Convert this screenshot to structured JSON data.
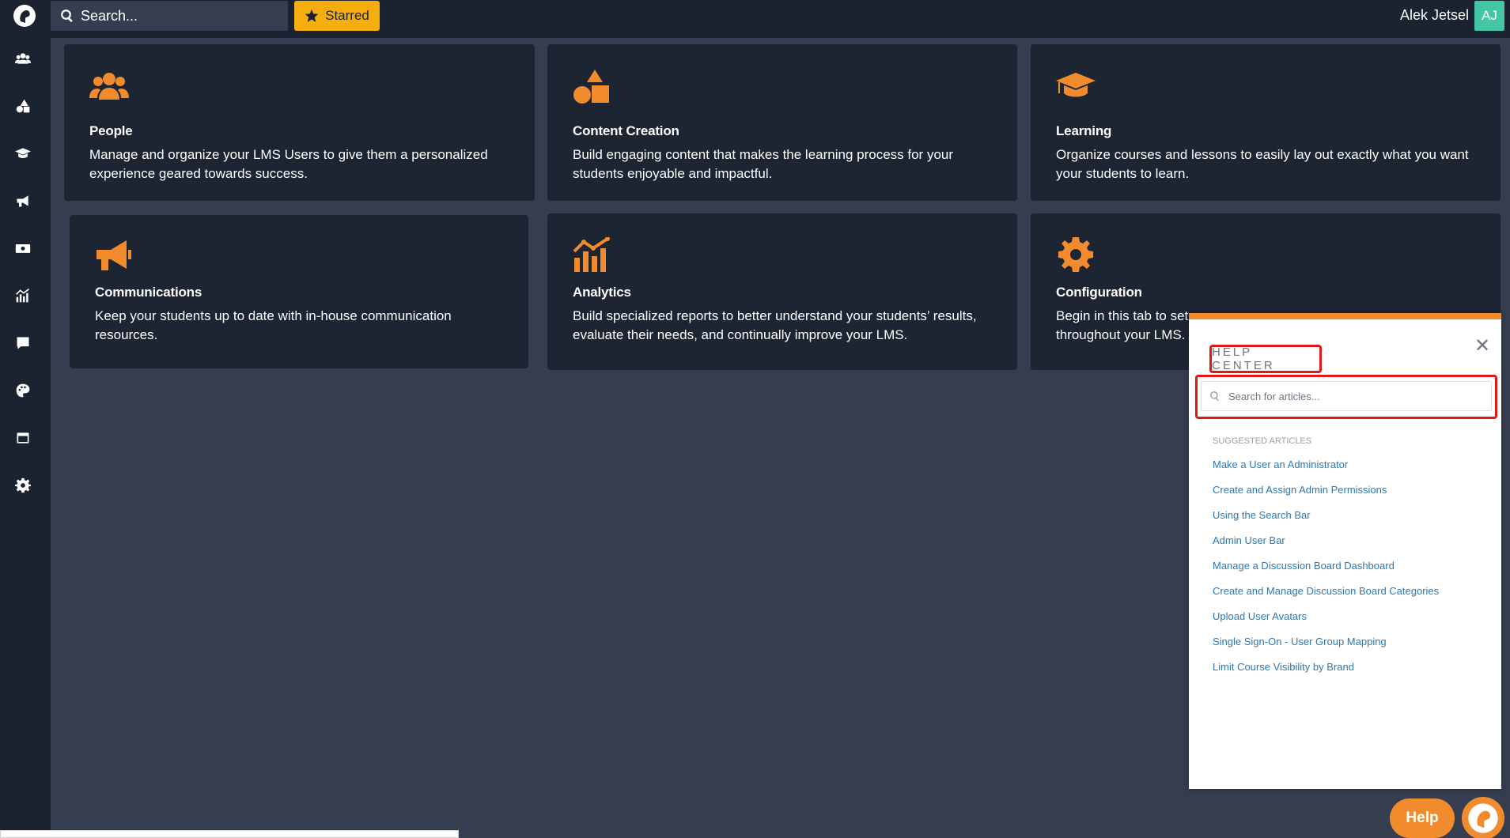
{
  "topbar": {
    "search_placeholder": "Search...",
    "starred_label": "Starred",
    "user_name": "Alek Jetsel",
    "user_initials": "AJ"
  },
  "sidebar": {
    "icons": [
      "logo-icon",
      "users-icon",
      "shapes-icon",
      "graduation-cap-icon",
      "megaphone-icon",
      "money-icon",
      "analytics-icon",
      "comment-icon",
      "palette-icon",
      "window-icon",
      "gear-icon"
    ]
  },
  "cards": [
    {
      "title": "People",
      "description": "Manage and organize your LMS Users to give them a personalized experience geared towards success.",
      "icon": "users-icon"
    },
    {
      "title": "Content Creation",
      "description": "Build engaging content that makes the learning process for your students enjoyable and impactful.",
      "icon": "shapes-icon"
    },
    {
      "title": "Learning",
      "description": "Organize courses and lessons to easily lay out exactly what you want your students to learn.",
      "icon": "graduation-cap-icon"
    },
    {
      "title": "Communications",
      "description": "Keep your students up to date with in-house communication resources.",
      "icon": "megaphone-icon"
    },
    {
      "title": "Analytics",
      "description": "Build specialized reports to better understand your students’ results, evaluate their needs, and continually improve your LMS.",
      "icon": "analytics-icon"
    },
    {
      "title": "Configuration",
      "description": "Begin in this tab to set",
      "description_line2": "throughout your LMS.",
      "icon": "gear-icon"
    }
  ],
  "help_center": {
    "title": "HELP CENTER",
    "search_placeholder": "Search for articles...",
    "suggested_label": "SUGGESTED ARTICLES",
    "articles": [
      "Make a User an Administrator",
      "Create and Assign Admin Permissions",
      "Using the Search Bar",
      "Admin User Bar",
      "Manage a Discussion Board Dashboard",
      "Create and Manage Discussion Board Categories",
      "Upload User Avatars",
      "Single Sign-On - User Group Mapping",
      "Limit Course Visibility by Brand"
    ]
  },
  "help_button": {
    "label": "Help"
  },
  "colors": {
    "sidebar_bg": "#1b2230",
    "page_bg": "#353e50",
    "card_bg": "#1d2432",
    "accent_orange": "#f28b2d",
    "starred_yellow": "#f6ae0f",
    "avatar_green": "#43c6a4",
    "highlight_red": "#e01818",
    "link_blue": "#2a79b8"
  }
}
